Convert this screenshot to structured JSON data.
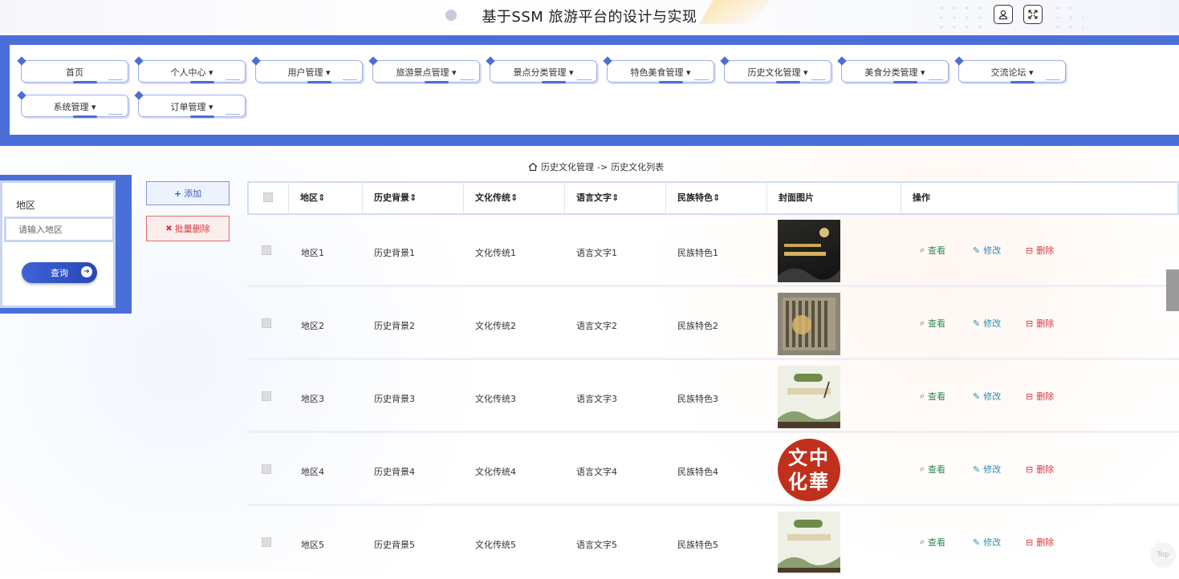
{
  "header": {
    "title": "基于SSM 旅游平台的设计与实现",
    "user_icon": "user-icon",
    "fullscreen_icon": "fullscreen-icon"
  },
  "nav": {
    "items": [
      {
        "label": "首页"
      },
      {
        "label": "个人中心 ▾"
      },
      {
        "label": "用户管理 ▾"
      },
      {
        "label": "旅游景点管理 ▾"
      },
      {
        "label": "景点分类管理 ▾"
      },
      {
        "label": "特色美食管理 ▾"
      },
      {
        "label": "历史文化管理 ▾"
      },
      {
        "label": "美食分类管理 ▾"
      },
      {
        "label": "交流论坛 ▾"
      },
      {
        "label": "系统管理 ▾"
      },
      {
        "label": "订单管理 ▾"
      }
    ]
  },
  "breadcrumb": {
    "section": "历史文化管理",
    "separator": "->",
    "page": "历史文化列表"
  },
  "search": {
    "label": "地区",
    "placeholder": "请输入地区",
    "button": "查询"
  },
  "actions": {
    "add": "添加",
    "batch_delete": "批量删除"
  },
  "table": {
    "headers": [
      "地区",
      "历史背景",
      "文化传统",
      "语言文字",
      "民族特色",
      "封面图片",
      "操作"
    ],
    "rows": [
      {
        "region": "地区1",
        "background": "历史背景1",
        "tradition": "文化传统1",
        "language": "语言文字1",
        "ethnic": "民族特色1",
        "image": "dark-poster"
      },
      {
        "region": "地区2",
        "background": "历史背景2",
        "tradition": "文化传统2",
        "language": "语言文字2",
        "ethnic": "民族特色2",
        "image": "bamboo-scroll"
      },
      {
        "region": "地区3",
        "background": "历史背景3",
        "tradition": "文化传统3",
        "language": "语言文字3",
        "ethnic": "民族特色3",
        "image": "landscape-card"
      },
      {
        "region": "地区4",
        "background": "历史背景4",
        "tradition": "文化传统4",
        "language": "语言文字4",
        "ethnic": "民族特色4",
        "image": "red-seal",
        "image_text": "文中化華"
      },
      {
        "region": "地区5",
        "background": "历史背景5",
        "tradition": "文化传统5",
        "language": "语言文字5",
        "ethnic": "民族特色5",
        "image": "landscape-card"
      }
    ],
    "row_actions": {
      "view": "查看",
      "edit": "修改",
      "delete": "删除"
    }
  },
  "colors": {
    "primary": "#4a6fd8",
    "view": "#2e8b57",
    "edit": "#2a8fb8",
    "delete": "#d9363e"
  },
  "back_to_top": "Top"
}
